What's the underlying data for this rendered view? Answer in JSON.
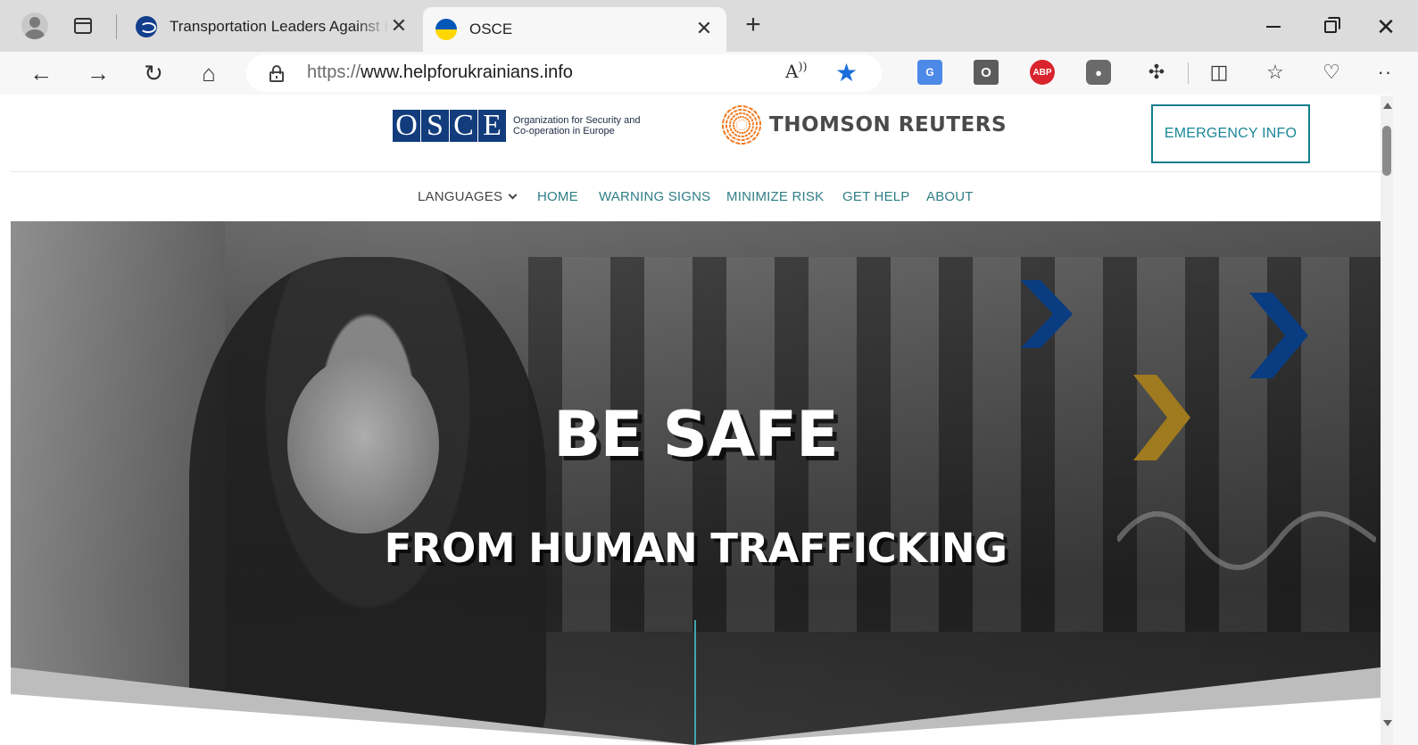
{
  "browser": {
    "tabs": [
      {
        "title": "Transportation Leaders Against H",
        "active": false
      },
      {
        "title": "OSCE",
        "active": true
      }
    ],
    "tab_close_glyph": "✕",
    "new_tab_glyph": "+",
    "window_close_glyph": "✕",
    "url_scheme": "https://",
    "url_host": "www.helpforukrainians.info",
    "read_aloud_glyph": "A̧",
    "favorite_star_glyph": "★",
    "extensions": {
      "translate": "G",
      "o_ext": "O",
      "adblock": "ABP",
      "shield": "●"
    },
    "icons": {
      "back": "←",
      "forward": "→",
      "reload": "↻",
      "home": "⌂",
      "puzzle": "✣",
      "split": "◫",
      "favorites": "☆",
      "health": "♡",
      "more": "···"
    }
  },
  "site": {
    "osce_letters": [
      "O",
      "S",
      "C",
      "E"
    ],
    "osce_tagline_line1": "Organization for Security and",
    "osce_tagline_line2": "Co-operation in Europe",
    "partner_name": "THOMSON REUTERS",
    "emergency_label": "EMERGENCY INFO",
    "nav": {
      "languages": "LANGUAGES",
      "home": "HOME",
      "warning_signs": "WARNING SIGNS",
      "minimize_risk": "MINIMIZE RISK",
      "get_help": "GET HELP",
      "about": "ABOUT"
    },
    "hero_title": "BE SAFE",
    "hero_subtitle": "FROM HUMAN TRAFFICKING"
  },
  "colors": {
    "osce_blue": "#123c7c",
    "teal": "#1a8796",
    "chevron_blue": "#0a3c82",
    "chevron_gold": "#a07a1e",
    "tr_orange": "#f07b22"
  }
}
